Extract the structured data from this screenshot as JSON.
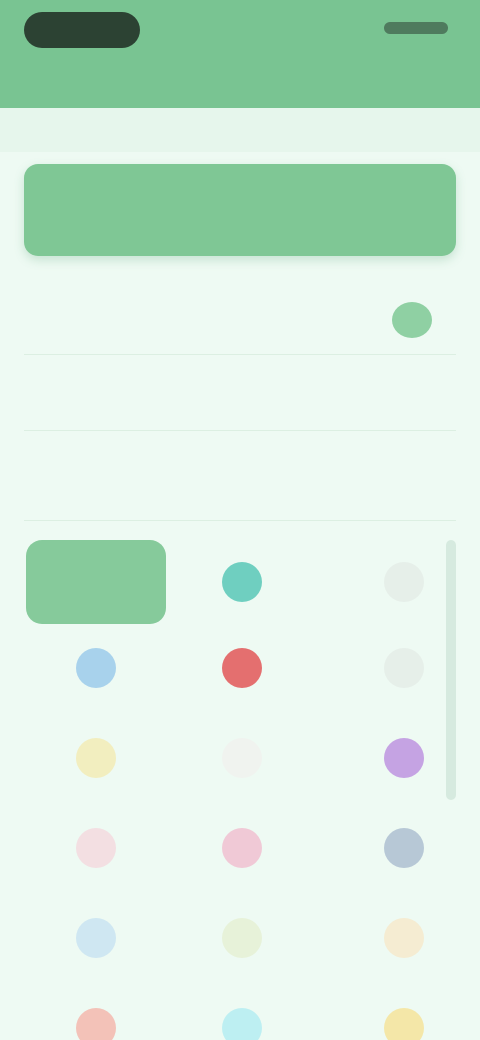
{
  "header": {
    "subtitle": ""
  },
  "primary_button": {
    "label": ""
  },
  "settings": {
    "row1_label": "",
    "row2_label": "",
    "row2_value": "",
    "row3_left": "",
    "row3_right": ""
  },
  "grid": {
    "items": [
      {
        "label": "",
        "color": "#86ca9b",
        "icon": "selected-tile"
      },
      {
        "label": "",
        "color": "#6fcfc0",
        "icon": "circle-teal"
      },
      {
        "label": "",
        "color": "#e6efe9",
        "icon": "circle-light"
      },
      {
        "label": "",
        "color": "#a8d2ec",
        "icon": "circle-blue"
      },
      {
        "label": "",
        "color": "#e46f6f",
        "icon": "circle-red"
      },
      {
        "label": "",
        "color": "#e6efe9",
        "icon": "circle-light"
      },
      {
        "label": "",
        "color": "#f2eebf",
        "icon": "circle-yellow"
      },
      {
        "label": "",
        "color": "#f0f3ef",
        "icon": "circle-pale"
      },
      {
        "label": "",
        "color": "#c5a3e3",
        "icon": "circle-purple"
      },
      {
        "label": "",
        "color": "#f3dfe2",
        "icon": "circle-pink"
      },
      {
        "label": "",
        "color": "#f0c9d6",
        "icon": "circle-rose"
      },
      {
        "label": "",
        "color": "#b7c8d6",
        "icon": "circle-steel"
      },
      {
        "label": "",
        "color": "#cfe7f2",
        "icon": "circle-sky"
      },
      {
        "label": "",
        "color": "#e7f2d9",
        "icon": "circle-lime"
      },
      {
        "label": "",
        "color": "#f5ecd2",
        "icon": "circle-cream"
      },
      {
        "label": "",
        "color": "#f3c2b8",
        "icon": "circle-salmon"
      },
      {
        "label": "",
        "color": "#bdeff2",
        "icon": "circle-cyan"
      },
      {
        "label": "",
        "color": "#f4e7a8",
        "icon": "circle-gold"
      }
    ]
  }
}
